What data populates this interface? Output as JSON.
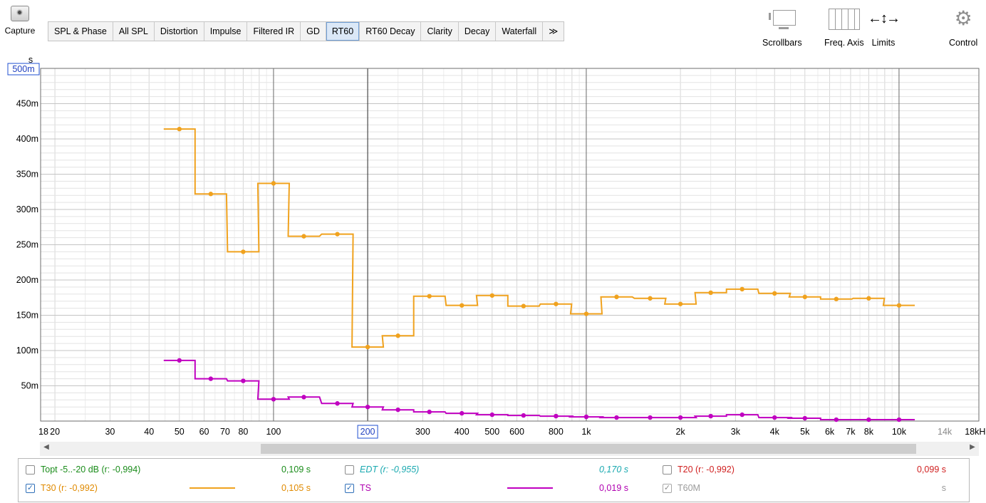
{
  "toolbar": {
    "capture_label": "Capture",
    "tabs": [
      {
        "label": "SPL & Phase"
      },
      {
        "label": "All SPL"
      },
      {
        "label": "Distortion"
      },
      {
        "label": "Impulse"
      },
      {
        "label": "Filtered IR"
      },
      {
        "label": "GD"
      },
      {
        "label": "RT60",
        "active": true
      },
      {
        "label": "RT60 Decay"
      },
      {
        "label": "Clarity"
      },
      {
        "label": "Decay"
      },
      {
        "label": "Waterfall"
      },
      {
        "label": "≫"
      }
    ],
    "tools": {
      "scrollbars": "Scrollbars",
      "freq_axis": "Freq. Axis",
      "limits": "Limits",
      "control": "Control"
    }
  },
  "chart_data": {
    "type": "line",
    "x_scale": "log",
    "xlim": [
      18,
      18000
    ],
    "ylim": [
      0,
      0.5
    ],
    "y_unit_label": "s",
    "y_ticks": [
      {
        "v": 0.5,
        "label": "500m",
        "boxed": true
      },
      {
        "v": 0.45,
        "label": "450m"
      },
      {
        "v": 0.4,
        "label": "400m"
      },
      {
        "v": 0.35,
        "label": "350m"
      },
      {
        "v": 0.3,
        "label": "300m"
      },
      {
        "v": 0.25,
        "label": "250m"
      },
      {
        "v": 0.2,
        "label": "200m"
      },
      {
        "v": 0.15,
        "label": "150m"
      },
      {
        "v": 0.1,
        "label": "100m"
      },
      {
        "v": 0.05,
        "label": "50m"
      }
    ],
    "x_ticks": [
      {
        "f": 18,
        "label": "18"
      },
      {
        "f": 20,
        "label": "20"
      },
      {
        "f": 30,
        "label": "30"
      },
      {
        "f": 40,
        "label": "40"
      },
      {
        "f": 50,
        "label": "50"
      },
      {
        "f": 60,
        "label": "60"
      },
      {
        "f": 70,
        "label": "70"
      },
      {
        "f": 80,
        "label": "80"
      },
      {
        "f": 100,
        "label": "100"
      },
      {
        "f": 200,
        "label": "200",
        "boxed": true
      },
      {
        "f": 300,
        "label": "300"
      },
      {
        "f": 400,
        "label": "400"
      },
      {
        "f": 500,
        "label": "500"
      },
      {
        "f": 600,
        "label": "600"
      },
      {
        "f": 800,
        "label": "800"
      },
      {
        "f": 1000,
        "label": "1k"
      },
      {
        "f": 2000,
        "label": "2k"
      },
      {
        "f": 3000,
        "label": "3k"
      },
      {
        "f": 4000,
        "label": "4k"
      },
      {
        "f": 5000,
        "label": "5k"
      },
      {
        "f": 6000,
        "label": "6k"
      },
      {
        "f": 7000,
        "label": "7k"
      },
      {
        "f": 8000,
        "label": "8k"
      },
      {
        "f": 10000,
        "label": "10k"
      },
      {
        "f": 14000,
        "label": "14k",
        "grey": true
      },
      {
        "f": 18000,
        "label": "18kHz"
      }
    ],
    "cursor_x": 200,
    "bands": [
      50,
      63,
      80,
      100,
      125,
      160,
      200,
      250,
      315,
      400,
      500,
      630,
      800,
      1000,
      1250,
      1600,
      2000,
      2500,
      3150,
      4000,
      5000,
      6300,
      8000,
      10000
    ],
    "series": [
      {
        "name": "T30",
        "color": "#f0a21e",
        "values": [
          0.414,
          0.322,
          0.24,
          0.337,
          0.262,
          0.265,
          0.105,
          0.121,
          0.177,
          0.164,
          0.178,
          0.163,
          0.166,
          0.152,
          0.176,
          0.174,
          0.166,
          0.182,
          0.187,
          0.181,
          0.176,
          0.173,
          0.174,
          0.164
        ]
      },
      {
        "name": "TS",
        "color": "#c000c0",
        "values": [
          0.086,
          0.06,
          0.057,
          0.031,
          0.034,
          0.025,
          0.02,
          0.016,
          0.013,
          0.011,
          0.009,
          0.008,
          0.007,
          0.006,
          0.005,
          0.005,
          0.005,
          0.007,
          0.009,
          0.005,
          0.004,
          0.002,
          0.002,
          0.002
        ]
      }
    ]
  },
  "legend": {
    "rows": [
      [
        {
          "checked": false,
          "label": "Topt -5..-20 dB (r: -0,994)",
          "value": "0,109 s",
          "color": "#1a8c1a",
          "italic": false
        },
        {
          "checked": false,
          "label": "EDT (r: -0,955)",
          "value": "0,170 s",
          "color": "#1aa9b0",
          "italic": true
        },
        {
          "checked": false,
          "label": "T20 (r: -0,992)",
          "value": "0,099 s",
          "color": "#d02020",
          "italic": false
        }
      ],
      [
        {
          "checked": true,
          "label": "T30 (r: -0,992)",
          "value": "0,105 s",
          "color": "#e08a00",
          "italic": false,
          "swatch": "#f0a21e"
        },
        {
          "checked": true,
          "label": "TS",
          "value": "0,019 s",
          "color": "#b000b0",
          "italic": false,
          "swatch": "#c000c0"
        },
        {
          "checked": true,
          "grey": true,
          "label": "T60M",
          "value": "s",
          "color": "#9a9a9a",
          "italic": false
        }
      ]
    ]
  }
}
